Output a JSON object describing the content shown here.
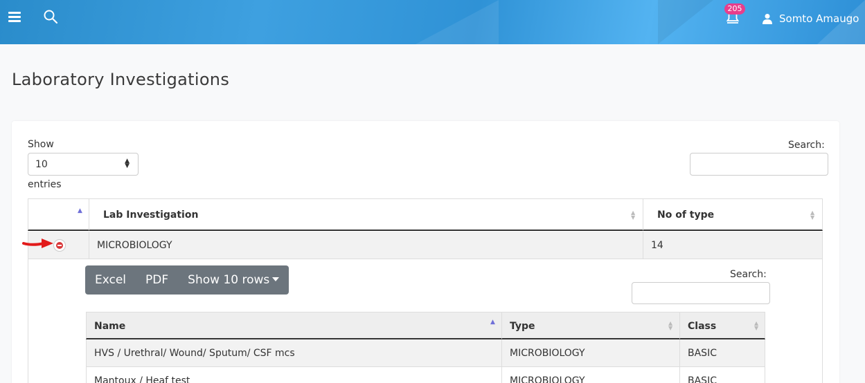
{
  "header": {
    "notifications_count": "205",
    "user_name": "Somto Amaugo",
    "icons": [
      "menu-icon",
      "search-icon",
      "bell-icon",
      "user-icon"
    ]
  },
  "page": {
    "title": "Laboratory Investigations"
  },
  "length_control": {
    "show_label": "Show",
    "value": "10",
    "entries_label": "entries"
  },
  "search": {
    "label": "Search:",
    "value": ""
  },
  "outer_table": {
    "columns": [
      "",
      "Lab Investigation",
      "No of type"
    ],
    "rows": [
      {
        "investigation": "MICROBIOLOGY",
        "count": "14"
      }
    ]
  },
  "child": {
    "buttons": {
      "excel": "Excel",
      "pdf": "PDF",
      "show_rows": "Show 10 rows"
    },
    "search_label": "Search:",
    "columns": [
      "Name",
      "Type",
      "Class"
    ],
    "rows": [
      {
        "name": "HVS / Urethral/ Wound/ Sputum/ CSF mcs",
        "type": "MICROBIOLOGY",
        "class": "BASIC"
      },
      {
        "name": "Mantoux / Heaf test",
        "type": "MICROBIOLOGY",
        "class": "BASIC"
      }
    ]
  },
  "colors": {
    "header_blue": "#2f92d6",
    "badge_pink": "#e83e8c",
    "sort_active": "#6f6fd8",
    "remove_red": "#d9383a",
    "button_gray": "#6c757d"
  }
}
